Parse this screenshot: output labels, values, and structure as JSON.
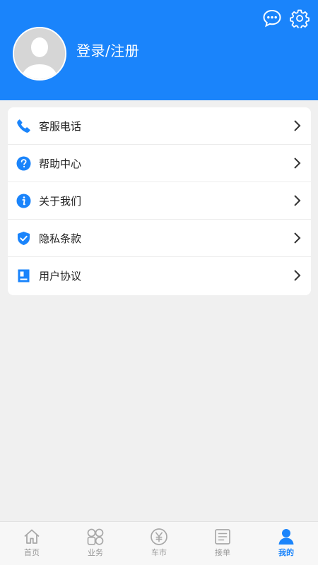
{
  "colors": {
    "brand": "#1a84fb",
    "background": "#f0f0f0",
    "tab_inactive": "#999999"
  },
  "header": {
    "login_label": "登录/注册",
    "icons": [
      "message-icon",
      "gear-icon"
    ]
  },
  "menu": {
    "items": [
      {
        "icon": "phone-icon",
        "label": "客服电话"
      },
      {
        "icon": "question-icon",
        "label": "帮助中心"
      },
      {
        "icon": "info-icon",
        "label": "关于我们"
      },
      {
        "icon": "shield-check-icon",
        "label": "隐私条款"
      },
      {
        "icon": "document-icon",
        "label": "用户协议"
      }
    ]
  },
  "tabbar": {
    "tabs": [
      {
        "icon": "home-icon",
        "label": "首页",
        "active": false
      },
      {
        "icon": "business-icon",
        "label": "业务",
        "active": false
      },
      {
        "icon": "yen-icon",
        "label": "车市",
        "active": false
      },
      {
        "icon": "orders-icon",
        "label": "接单",
        "active": false
      },
      {
        "icon": "person-icon",
        "label": "我的",
        "active": true
      }
    ]
  }
}
